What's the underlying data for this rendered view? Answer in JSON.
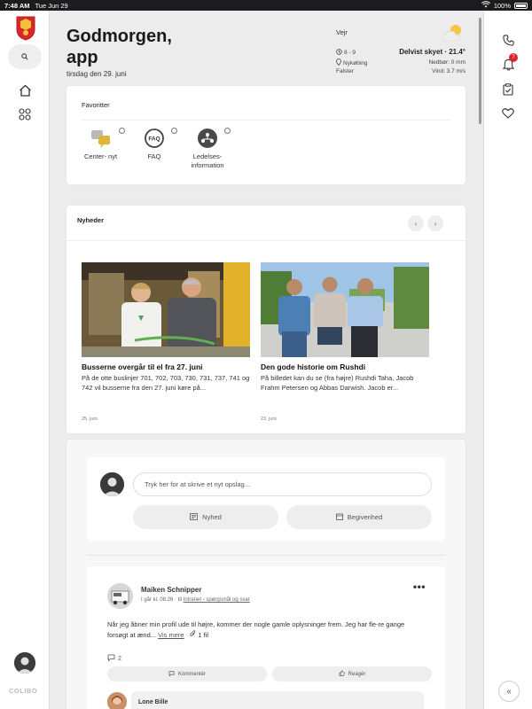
{
  "status_bar": {
    "time": "7:48 AM",
    "date": "Tue Jun 29",
    "battery": "100%"
  },
  "header": {
    "greeting": "Godmorgen, app",
    "date": "tirsdag den 29. juni"
  },
  "weather": {
    "title": "Vejr",
    "hours": "8 - 9",
    "location": "Nykøbing",
    "region": "Falster",
    "condition": "Delvist skyet · 21.4°",
    "rain": "Nedbør: 0 mm",
    "wind": "Vind: 3.7 m/s",
    "icon": "partly-cloudy-icon"
  },
  "favorites": {
    "title": "Favoritter",
    "items": [
      {
        "label": "Center- nyt",
        "icon": "center-nyt-icon"
      },
      {
        "label": "FAQ",
        "icon": "faq-icon"
      },
      {
        "label": "Ledelses-\ninformation",
        "icon": "ledelses-icon"
      }
    ]
  },
  "news": {
    "title": "Nyheder",
    "items": [
      {
        "headline": "Busserne overgår til el fra 27. juni",
        "text": "På de otte buslinjer 701, 702, 703, 730, 731, 737, 741 og 742 vil busserne fra den 27. juni køre på...",
        "date": "25. juni"
      },
      {
        "headline": "Den gode historie om Rushdi",
        "text": "På billedet kan du se (fra højre) Rushdi Taha, Jacob Frahm Petersen og Abbas Darwish. Jacob er...",
        "date": "23. juni"
      }
    ]
  },
  "composer": {
    "placeholder": "Tryk her for at skrive et nyt opslag...",
    "news_label": "Nyhed",
    "event_label": "Begivenhed"
  },
  "post": {
    "author": "Maiken Schnipper",
    "time": "I går kl. 08:26 · til",
    "group": "Intranet - spørgsmål og svar",
    "body": "Når jeg åbner min profil ude til højre, kommer der nogle gamle oplysninger frem. Jeg har fle-re gange forsøgt at ænd...",
    "more": "Vis mere",
    "files": "1 fil",
    "comments": "2",
    "comment_label": "Kommentér",
    "react_label": "Reagér",
    "commenter": "Lone Bille"
  },
  "brand": {
    "footer": "COLIBO",
    "accent": "#d9262b"
  },
  "right_bar": {
    "notification_count": "7"
  }
}
